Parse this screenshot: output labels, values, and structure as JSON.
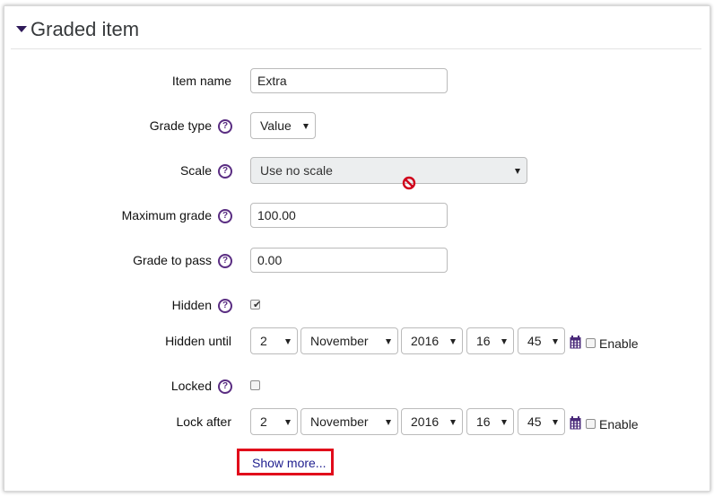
{
  "section": {
    "title": "Graded item",
    "collapse_icon": "caret-down-icon"
  },
  "fields": {
    "item_name": {
      "label": "Item name",
      "value": "Extra"
    },
    "grade_type": {
      "label": "Grade type",
      "value": "Value"
    },
    "scale": {
      "label": "Scale",
      "value": "Use no scale",
      "disabled_icon": "no-entry-icon"
    },
    "maximum_grade": {
      "label": "Maximum grade",
      "value": "100.00"
    },
    "grade_to_pass": {
      "label": "Grade to pass",
      "value": "0.00"
    },
    "hidden": {
      "label": "Hidden",
      "checked": true
    },
    "hidden_until": {
      "label": "Hidden until",
      "day": "2",
      "month": "November",
      "year": "2016",
      "hour": "16",
      "minute": "45",
      "enable_label": "Enable"
    },
    "locked": {
      "label": "Locked",
      "checked": false
    },
    "lock_after": {
      "label": "Lock after",
      "day": "2",
      "month": "November",
      "year": "2016",
      "hour": "16",
      "minute": "45",
      "enable_label": "Enable"
    }
  },
  "help_icon": "question-circle-icon",
  "calendar_icon": "calendar-icon",
  "show_more": {
    "label": "Show more..."
  },
  "colors": {
    "accent": "#5a2d82",
    "highlight_border": "#e10b1b",
    "link": "#1f1f8f"
  }
}
